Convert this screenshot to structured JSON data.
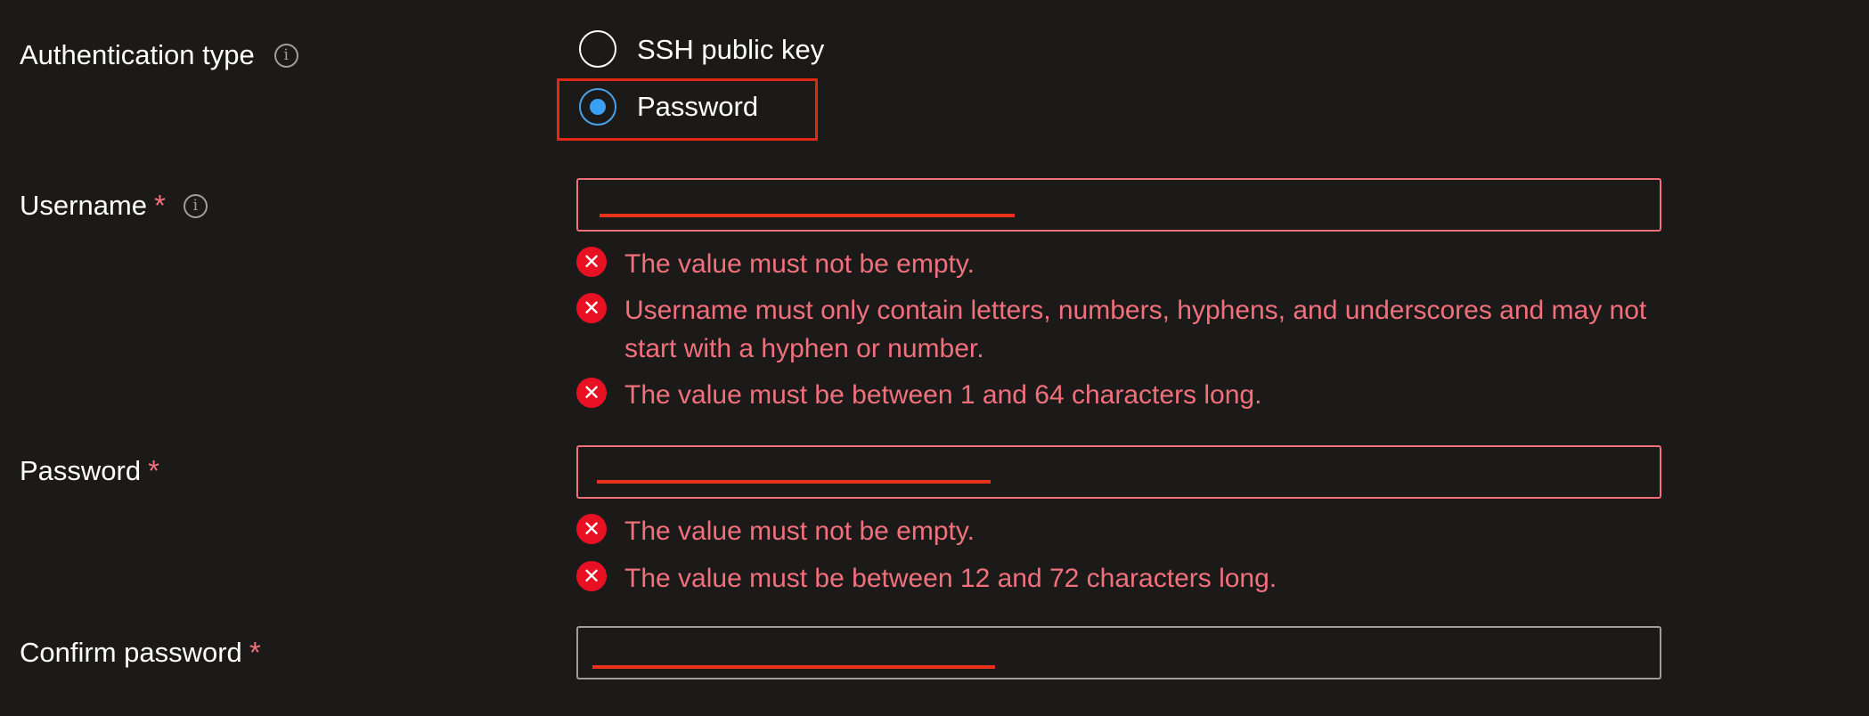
{
  "auth_type": {
    "label": "Authentication type",
    "info_icon": "info-icon",
    "options": [
      {
        "label": "SSH public key",
        "selected": false
      },
      {
        "label": "Password",
        "selected": true
      }
    ]
  },
  "username": {
    "label": "Username",
    "required_marker": "*",
    "info_icon": "info-icon",
    "value": "",
    "errors": [
      "The value must not be empty.",
      "Username must only contain letters, numbers, hyphens, and underscores and may not start with a hyphen or number.",
      "The value must be between 1 and 64 characters long."
    ]
  },
  "password": {
    "label": "Password",
    "required_marker": "*",
    "value": "",
    "errors": [
      "The value must not be empty.",
      "The value must be between 12 and 72 characters long."
    ]
  },
  "confirm_password": {
    "label": "Confirm password",
    "required_marker": "*",
    "value": ""
  },
  "colors": {
    "background": "#1b1a19",
    "error_text": "#f1707b",
    "error_icon": "#e81123",
    "radio_selected": "#3aa0f3",
    "highlight_box": "#e02812"
  },
  "icons": {
    "error": "error-circle-icon",
    "info": "info-icon"
  }
}
